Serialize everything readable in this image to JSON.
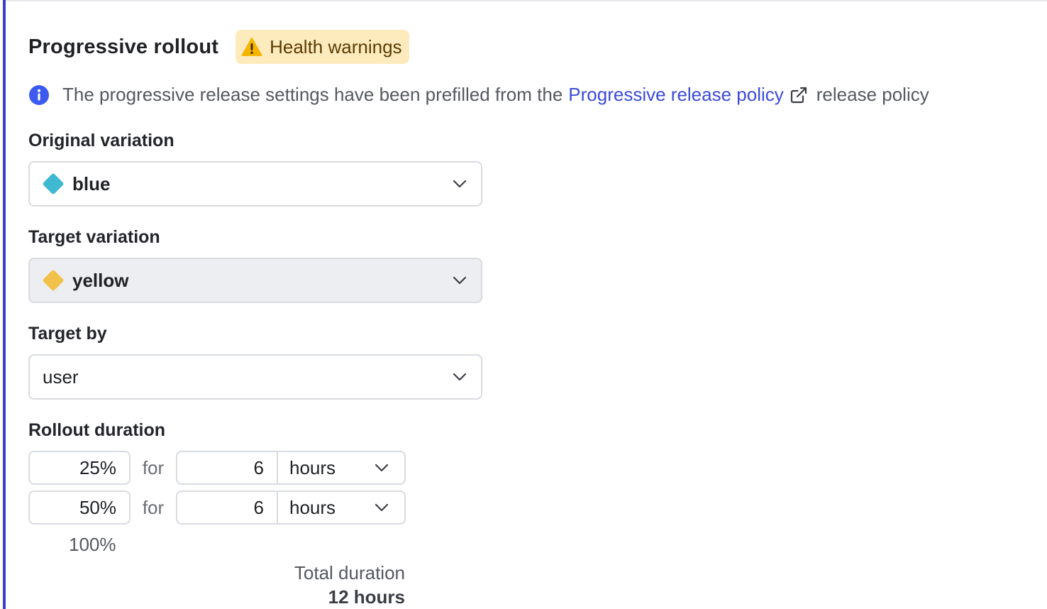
{
  "section": {
    "title": "Progressive rollout",
    "badge_label": "Health warnings"
  },
  "info": {
    "text_before": "The progressive release settings have been prefilled from the",
    "link_text": "Progressive release policy",
    "text_after": "release policy"
  },
  "original_variation": {
    "label": "Original variation",
    "value": "blue",
    "color": "#3fb8d2"
  },
  "target_variation": {
    "label": "Target variation",
    "value": "yellow",
    "color": "#f2c14a"
  },
  "target_by": {
    "label": "Target by",
    "value": "user"
  },
  "rollout": {
    "label": "Rollout duration",
    "for_label": "for",
    "steps": [
      {
        "percent": "25%",
        "duration": "6",
        "unit": "hours"
      },
      {
        "percent": "50%",
        "duration": "6",
        "unit": "hours"
      }
    ],
    "final_percent": "100%",
    "total_label": "Total duration",
    "total_value": "12 hours"
  },
  "colors": {
    "accent": "#3d3fc9",
    "link": "#3b4bd8",
    "warning_bg": "#fdebbd",
    "warning_icon": "#f5b400"
  },
  "icons": {
    "badge": "warning-triangle-icon",
    "info": "info-circle-icon",
    "link": "external-link-icon",
    "select": "chevron-down-icon"
  }
}
